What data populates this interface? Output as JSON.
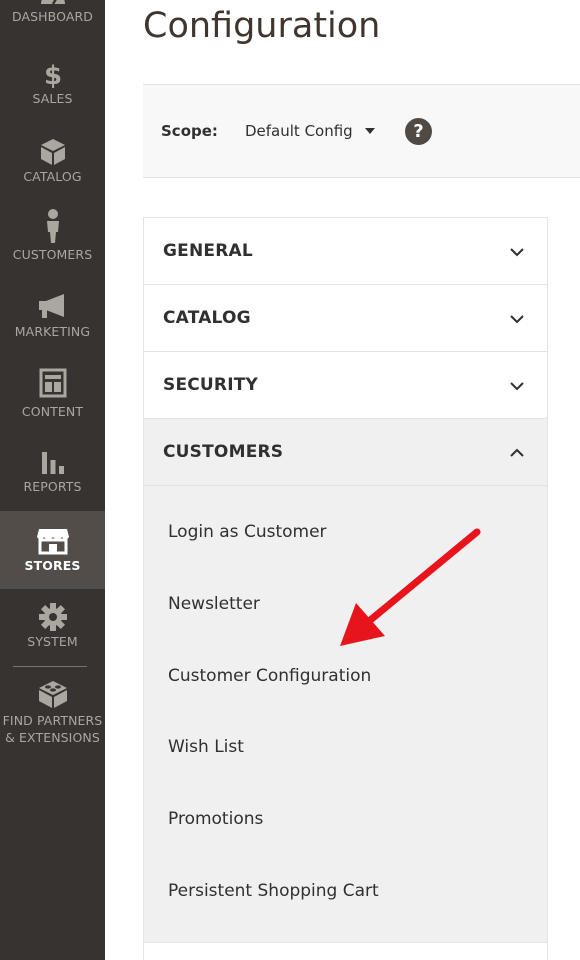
{
  "sidebar": {
    "items": [
      {
        "label": "DASHBOARD",
        "icon": "dashboard-icon"
      },
      {
        "label": "SALES",
        "icon": "dollar-icon"
      },
      {
        "label": "CATALOG",
        "icon": "box-icon"
      },
      {
        "label": "CUSTOMERS",
        "icon": "person-icon"
      },
      {
        "label": "MARKETING",
        "icon": "megaphone-icon"
      },
      {
        "label": "CONTENT",
        "icon": "layout-icon"
      },
      {
        "label": "REPORTS",
        "icon": "bar-chart-icon"
      },
      {
        "label": "STORES",
        "icon": "store-icon",
        "active": true
      },
      {
        "label": "SYSTEM",
        "icon": "gear-icon"
      },
      {
        "label_line1": "FIND PARTNERS",
        "label_line2": "& EXTENSIONS",
        "icon": "blocks-icon"
      }
    ]
  },
  "page": {
    "title": "Configuration"
  },
  "scope": {
    "label": "Scope:",
    "value": "Default Config",
    "help": "?"
  },
  "config_sections": [
    {
      "title": "GENERAL",
      "expanded": false
    },
    {
      "title": "CATALOG",
      "expanded": false
    },
    {
      "title": "SECURITY",
      "expanded": false
    },
    {
      "title": "CUSTOMERS",
      "expanded": true
    }
  ],
  "customers_links": [
    "Login as Customer",
    "Newsletter",
    "Customer Configuration",
    "Wish List",
    "Promotions",
    "Persistent Shopping Cart"
  ],
  "colors": {
    "sidebar_bg": "#373330",
    "sidebar_active_bg": "#524d49",
    "annotation_arrow": "#e8141b"
  }
}
